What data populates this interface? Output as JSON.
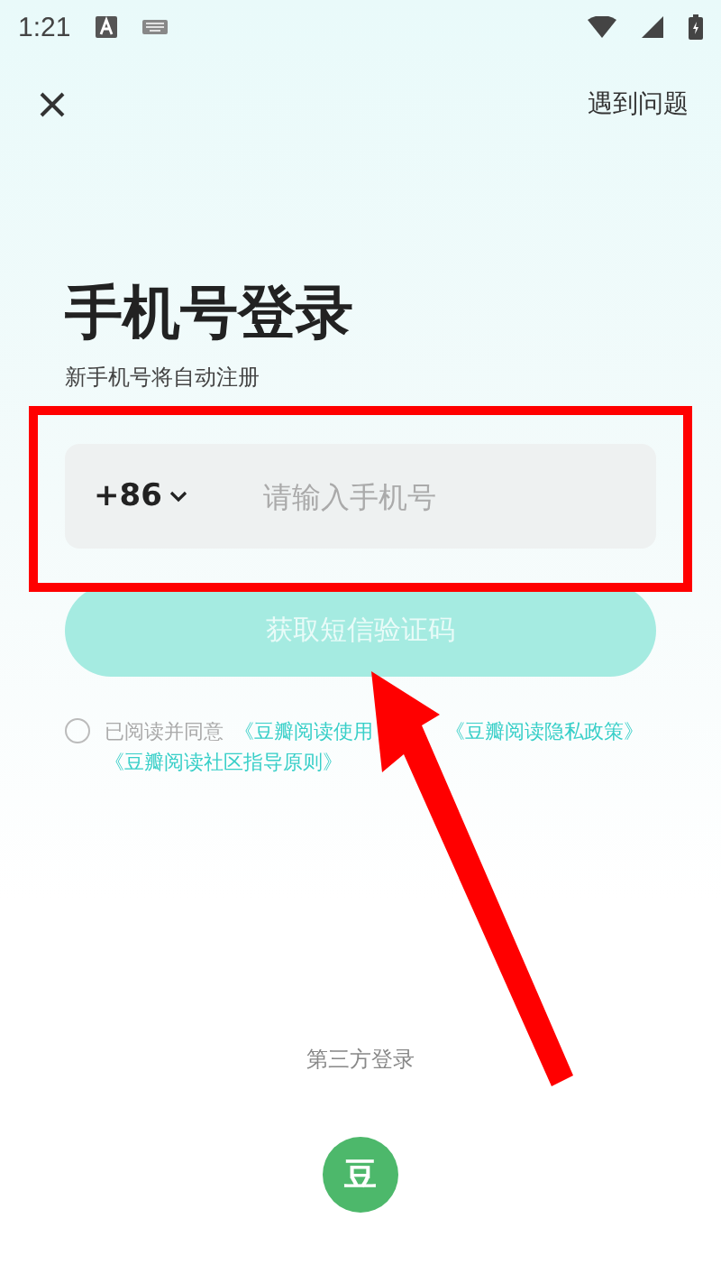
{
  "status_bar": {
    "time": "1:21"
  },
  "top_bar": {
    "help": "遇到问题"
  },
  "title": "手机号登录",
  "subtitle": "新手机号将自动注册",
  "phone": {
    "country_code": "+86",
    "placeholder": "请输入手机号"
  },
  "sms_button": {
    "label": "获取短信验证码",
    "disabled": true
  },
  "agreement": {
    "checked": false,
    "text": "已阅读并同意",
    "links": [
      "《豆瓣阅读使用",
      "《豆瓣阅读隐私政策》",
      "《豆瓣阅读社区指导原则》"
    ]
  },
  "third_party": {
    "label": "第三方登录",
    "providers": [
      {
        "label": "豆"
      }
    ]
  }
}
